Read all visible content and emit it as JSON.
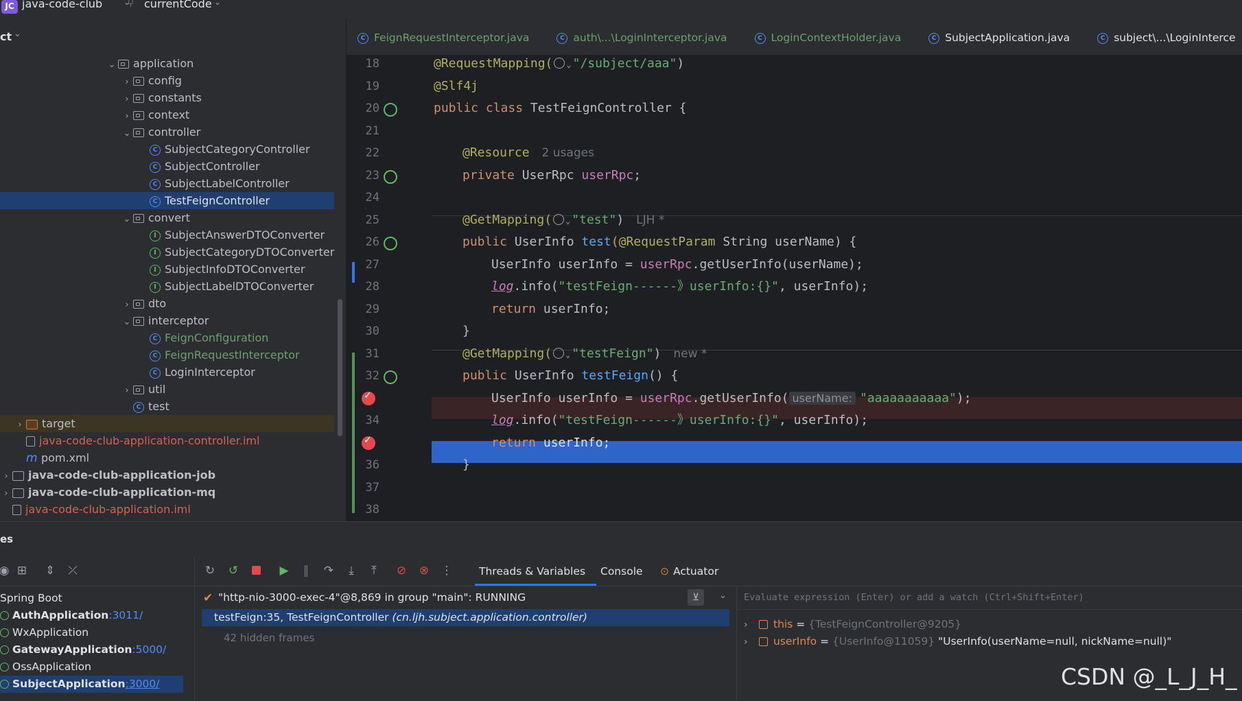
{
  "titlebar": {
    "app_badge": "JC",
    "project": "java-code-club",
    "branch": "currentCode"
  },
  "project_panel": {
    "title": "ct",
    "tree": [
      {
        "label": "application",
        "kind": "folder",
        "level": 1,
        "expanded": true
      },
      {
        "label": "config",
        "kind": "folder",
        "level": 2,
        "expanded": false
      },
      {
        "label": "constants",
        "kind": "folder",
        "level": 2,
        "expanded": false
      },
      {
        "label": "context",
        "kind": "folder",
        "level": 2,
        "expanded": false
      },
      {
        "label": "controller",
        "kind": "folder",
        "level": 2,
        "expanded": true
      },
      {
        "label": "SubjectCategoryController",
        "kind": "class",
        "level": 3
      },
      {
        "label": "SubjectController",
        "kind": "class",
        "level": 3
      },
      {
        "label": "SubjectLabelController",
        "kind": "class",
        "level": 3
      },
      {
        "label": "TestFeignController",
        "kind": "class",
        "level": 3,
        "selected": true
      },
      {
        "label": "convert",
        "kind": "folder",
        "level": 2,
        "expanded": true
      },
      {
        "label": "SubjectAnswerDTOConverter",
        "kind": "interface",
        "level": 3
      },
      {
        "label": "SubjectCategoryDTOConverter",
        "kind": "interface",
        "level": 3
      },
      {
        "label": "SubjectInfoDTOConverter",
        "kind": "interface",
        "level": 3
      },
      {
        "label": "SubjectLabelDTOConverter",
        "kind": "interface",
        "level": 3
      },
      {
        "label": "dto",
        "kind": "folder",
        "level": 2,
        "expanded": false
      },
      {
        "label": "interceptor",
        "kind": "folder",
        "level": 2,
        "expanded": true
      },
      {
        "label": "FeignConfiguration",
        "kind": "class",
        "level": 3,
        "color": "green"
      },
      {
        "label": "FeignRequestInterceptor",
        "kind": "class",
        "level": 3,
        "color": "green"
      },
      {
        "label": "LoginInterceptor",
        "kind": "class",
        "level": 3
      },
      {
        "label": "util",
        "kind": "folder",
        "level": 2,
        "expanded": false
      },
      {
        "label": "test",
        "kind": "class",
        "level": 2
      },
      {
        "label": "target",
        "kind": "target",
        "level": 0,
        "expanded": false
      },
      {
        "label": "java-code-club-application-controller.iml",
        "kind": "file",
        "level": 0,
        "color": "red"
      },
      {
        "label": "pom.xml",
        "kind": "maven",
        "level": 0
      },
      {
        "label": "java-code-club-application-job",
        "kind": "module",
        "level": -1,
        "bold": true
      },
      {
        "label": "java-code-club-application-mq",
        "kind": "module",
        "level": -1,
        "bold": true
      },
      {
        "label": "java-code-club-application.iml",
        "kind": "file",
        "level": -1,
        "color": "red"
      }
    ]
  },
  "tabs": [
    {
      "label": "FeignRequestInterceptor.java",
      "color": "green"
    },
    {
      "label": "auth\\...\\LoginInterceptor.java",
      "color": "green"
    },
    {
      "label": "LoginContextHolder.java",
      "color": "green"
    },
    {
      "label": "SubjectApplication.java",
      "color": "default"
    },
    {
      "label": "subject\\...\\LoginInterce",
      "color": "default"
    }
  ],
  "editor": {
    "line_numbers": [
      "18",
      "19",
      "20",
      "21",
      "22",
      "23",
      "24",
      "25",
      "26",
      "27",
      "28",
      "29",
      "30",
      "31",
      "32",
      "",
      "34",
      "",
      "36",
      "37",
      "38"
    ],
    "code": {
      "l18_ann": "@RequestMapping(",
      "l18_str": "\"/subject/aaa\"",
      "l18_end": ")",
      "l19": "@Slf4j",
      "l20_kw": "public class ",
      "l20_cls": "TestFeignController {",
      "l22_ann": "@Resource",
      "l22_hint": "2 usages",
      "l23_kw": "private ",
      "l23_type": "UserRpc ",
      "l23_fld": "userRpc",
      "l23_end": ";",
      "l25_ann": "@GetMapping(",
      "l25_str": "\"test\"",
      "l25_end": ")",
      "l25_author": "LJH *",
      "l26_kw": "public ",
      "l26_type": "UserInfo ",
      "l26_fn": "test",
      "l26_ann": "(@RequestParam ",
      "l26_rest": "String userName) {",
      "l27_a": "UserInfo userInfo = ",
      "l27_fld": "userRpc",
      "l27_b": ".getUserInfo(userName);",
      "l28_log": "log",
      "l28_a": ".info(",
      "l28_str": "\"testFeign------》userInfo:{}\"",
      "l28_b": ", userInfo);",
      "l29_kw": "return ",
      "l29_rest": "userInfo;",
      "l30": "}",
      "l31_ann": "@GetMapping(",
      "l31_str": "\"testFeign\"",
      "l31_end": ")",
      "l31_hint": "new *",
      "l32_kw": "public ",
      "l32_type": "UserInfo ",
      "l32_fn": "testFeign",
      "l32_rest": "() {",
      "l33_a": "UserInfo userInfo = ",
      "l33_fld": "userRpc",
      "l33_b": ".getUserInfo(",
      "l33_inlay": "userName:",
      "l33_str": "\"aaaaaaaaaaa\"",
      "l33_end": ");",
      "l34_log": "log",
      "l34_a": ".info(",
      "l34_str": "\"testFeign------》userInfo:{}\"",
      "l34_b": ", userInfo);",
      "l35_kw": "return ",
      "l35_rest": "userInfo;",
      "l36": "}"
    }
  },
  "services": {
    "title": "es",
    "debug_tabs": [
      {
        "label": "Threads & Variables",
        "active": true
      },
      {
        "label": "Console",
        "active": false
      },
      {
        "label": "Actuator",
        "active": false
      }
    ],
    "list": [
      {
        "label": "Spring Boot",
        "port": "",
        "bold": false
      },
      {
        "label": "AuthApplication",
        "port": ":3011/",
        "bold": true
      },
      {
        "label": "WxApplication",
        "port": "",
        "bold": false
      },
      {
        "label": "GatewayApplication",
        "port": ":5000/",
        "bold": true
      },
      {
        "label": "OssApplication",
        "port": "",
        "bold": false
      },
      {
        "label": "SubjectApplication",
        "port": ":3000/",
        "bold": true,
        "selected": true
      }
    ],
    "thread": "\"http-nio-3000-exec-4\"@8,869 in group \"main\": RUNNING",
    "frame_main": "testFeign:35, TestFeignController ",
    "frame_pkg": "(cn.ljh.subject.application.controller)",
    "hidden_frames": "42 hidden frames",
    "eval_placeholder": "Evaluate expression (Enter) or add a watch (Ctrl+Shift+Enter)",
    "variables": [
      {
        "name": "this",
        "eq": " = ",
        "ref": "{TestFeignController@9205}",
        "value": ""
      },
      {
        "name": "userInfo",
        "eq": " = ",
        "ref": "{UserInfo@11059} ",
        "value": "\"UserInfo(userName=null, nickName=null)\""
      }
    ],
    "watermark": "CSDN @_L_J_H_"
  },
  "colors": {
    "accent": "#548af7",
    "selection": "#2f65ca",
    "breakpoint": "#e5484d",
    "green_file": "#6f9e6f"
  }
}
